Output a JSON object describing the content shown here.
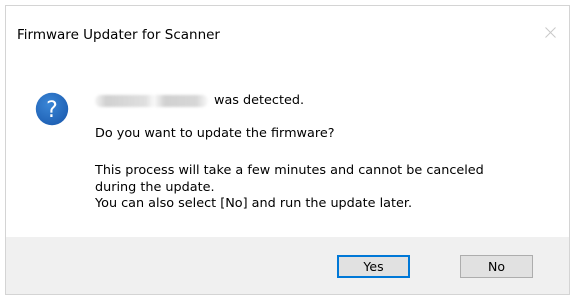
{
  "window": {
    "title": "Firmware Updater for Scanner",
    "close_icon": "close-icon"
  },
  "message": {
    "icon": "question-icon",
    "icon_color": "#1e66bd",
    "detected_suffix": "was detected.",
    "question": "Do you want to update the firmware?",
    "note_line1": "This process will take a few minutes and cannot be canceled",
    "note_line2": "during the update.",
    "note_line3": "You can also select [No] and run the update later."
  },
  "buttons": {
    "yes_label": "Yes",
    "no_label": "No"
  },
  "colors": {
    "focus_border": "#0078d7",
    "footer_bg": "#f0f0f0",
    "button_bg": "#e1e1e1"
  }
}
